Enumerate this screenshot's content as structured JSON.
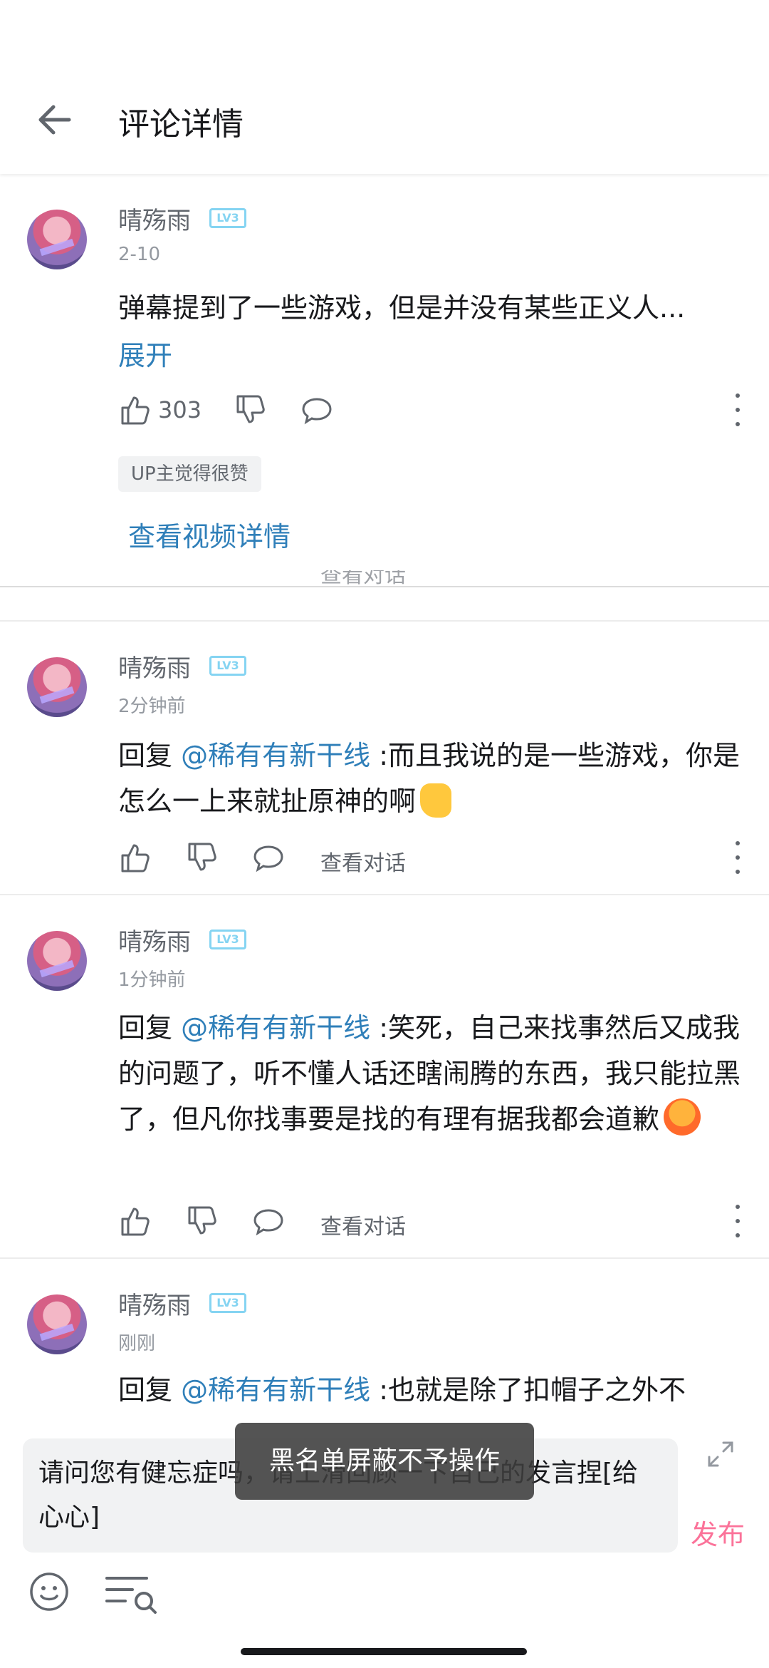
{
  "header": {
    "title": "评论详情"
  },
  "root_comment": {
    "username": "晴殇雨",
    "level": "LV3",
    "time": "2-10",
    "text": "弹幕提到了一些游戏，但是并没有某些正义人...",
    "expand_label": "展开",
    "like_count": "303",
    "up_badge": "UP主觉得很赞",
    "video_link": "查看视频详情",
    "ghost_action": "查看对话"
  },
  "replies": [
    {
      "username": "晴殇雨",
      "level": "LV3",
      "time": "2分钟前",
      "prefix": "回复 ",
      "mention": "@稀有有新干线",
      "text": " :而且我说的是一些游戏，你是怎么一上来就扯原神的啊",
      "action_label": "查看对话"
    },
    {
      "username": "晴殇雨",
      "level": "LV3",
      "time": "1分钟前",
      "prefix": "回复 ",
      "mention": "@稀有有新干线",
      "text": " :笑死，自己来找事然后又成我的问题了，听不懂人话还瞎闹腾的东西，我只能拉黑了，但凡你找事要是找的有理有据我都会道歉",
      "action_label": "查看对话"
    },
    {
      "username": "晴殇雨",
      "level": "LV3",
      "time": "刚刚",
      "prefix": "回复 ",
      "mention": "@稀有有新干线",
      "text": " :也就是除了扣帽子之外不"
    }
  ],
  "input": {
    "text": "请问您有健忘症吗，请上滑回顾一下自己的发言捏[给心心]",
    "publish_label": "发布"
  },
  "toast": "黑名单屏蔽不予操作",
  "colors": {
    "accent": "#fb7299",
    "link": "#2f7fb9",
    "level": "#85d4f2"
  }
}
